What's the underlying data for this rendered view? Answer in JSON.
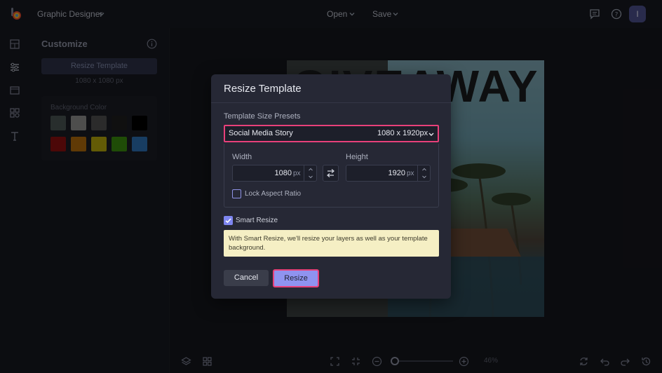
{
  "header": {
    "app_title": "Graphic Designer",
    "menu_open": "Open",
    "menu_save": "Save",
    "avatar_initial": "I"
  },
  "left_rail": {
    "icons": [
      "layouts-icon",
      "adjust-sliders-icon",
      "background-icon",
      "graphics-icon",
      "text-icon"
    ]
  },
  "customize_panel": {
    "title": "Customize",
    "resize_button": "Resize Template",
    "size_text": "1080 x 1080 px",
    "background_color_label": "Background Color",
    "swatches": [
      "#4a5453",
      "#8e8f8d",
      "#4f4f4f",
      "#1e1e1e",
      "#000000",
      "#8b1010",
      "#b06a0c",
      "#b5a60c",
      "#3a8a0e",
      "#2c6fb3"
    ]
  },
  "canvas": {
    "headline": "GIVEAWAY"
  },
  "bottom_toolbar": {
    "zoom_label": "46%"
  },
  "modal": {
    "title": "Resize Template",
    "presets_label": "Template Size Presets",
    "preset_name": "Social Media Story",
    "preset_size": "1080 x 1920px",
    "width_label": "Width",
    "width_value": "1080",
    "height_label": "Height",
    "height_value": "1920",
    "unit": "px",
    "lock_aspect_label": "Lock Aspect Ratio",
    "lock_aspect_checked": false,
    "smart_resize_label": "Smart Resize",
    "smart_resize_checked": true,
    "smart_resize_note": "With Smart Resize, we'll resize your layers as well as your template background.",
    "cancel_label": "Cancel",
    "resize_label": "Resize"
  },
  "colors": {
    "highlight": "#e8407a",
    "accent": "#8f93f0",
    "note_bg": "#f5efc4"
  }
}
